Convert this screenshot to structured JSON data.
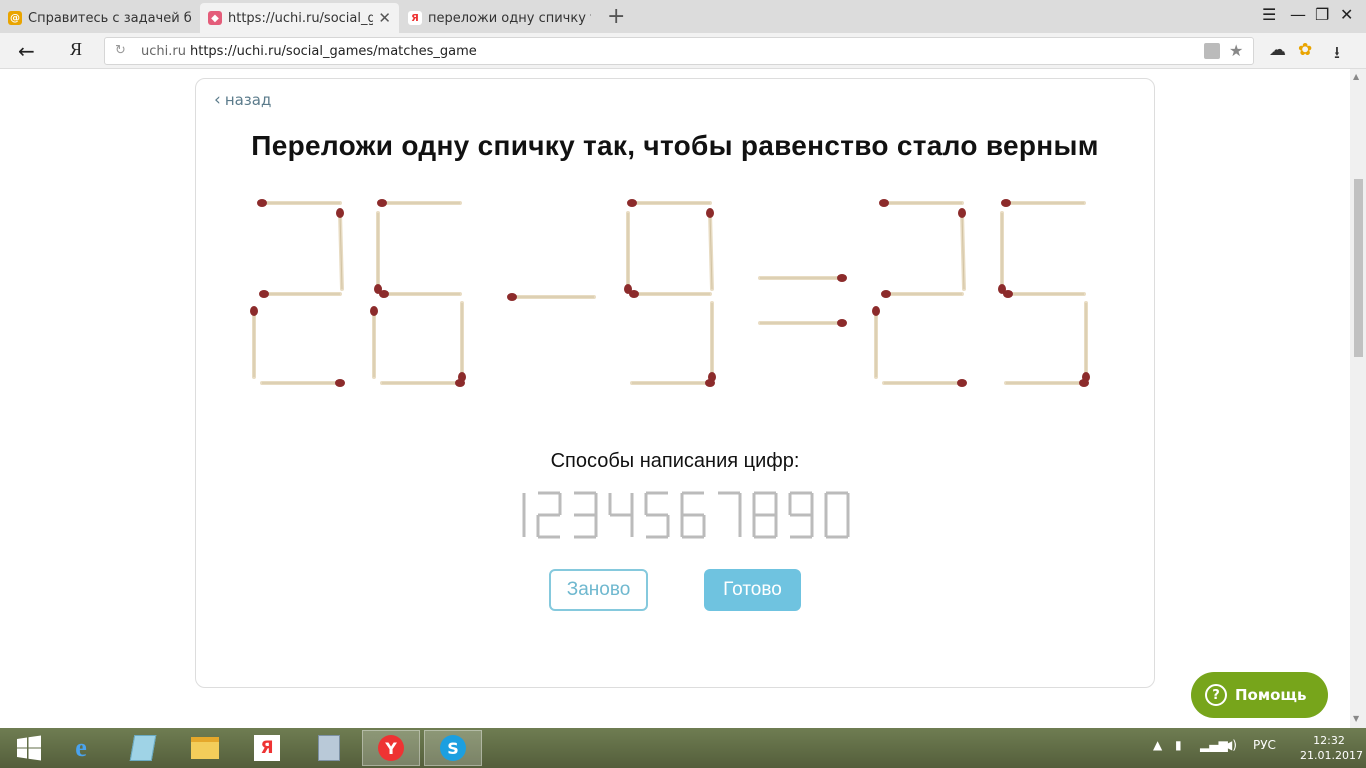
{
  "browser": {
    "tabs": [
      {
        "label": "Справитесь с задачей быстр",
        "favicon": "globe-icon",
        "active": false
      },
      {
        "label": "https://uchi.ru/social_gam",
        "favicon": "uchi-icon",
        "active": true
      },
      {
        "label": "переложи одну спичку так",
        "favicon": "yandex-icon",
        "active": false
      }
    ],
    "new_tab": "+",
    "address": {
      "host": "uchi.ru",
      "url": "https://uchi.ru/social_games/matches_game"
    },
    "logo": "Я"
  },
  "page": {
    "back_label": "назад",
    "title": "Переложи одну спичку так, чтобы равенство стало верным",
    "equation": [
      "2",
      "6",
      "-",
      "9",
      "=",
      "2",
      "5"
    ],
    "ways_label": "Способы написания цифр:",
    "sample_digits": [
      "1",
      "2",
      "3",
      "4",
      "5",
      "6",
      "7",
      "8",
      "9",
      "0"
    ],
    "restart_button": "Заново",
    "done_button": "Готово",
    "help_button": "Помощь",
    "colors": {
      "accent": "#6fc3e0",
      "help": "#77a51b",
      "match_head": "#8c2b2b",
      "match_stick": "#e8dcc3"
    }
  },
  "taskbar": {
    "apps": [
      "windows-start-icon",
      "ie-icon",
      "explorer-icon",
      "folder-icon",
      "yandex-icon",
      "calculator-icon",
      "yandex-browser-icon",
      "skype-icon"
    ],
    "lang": "РУС",
    "time": "12:32",
    "date": "21.01.2017"
  }
}
